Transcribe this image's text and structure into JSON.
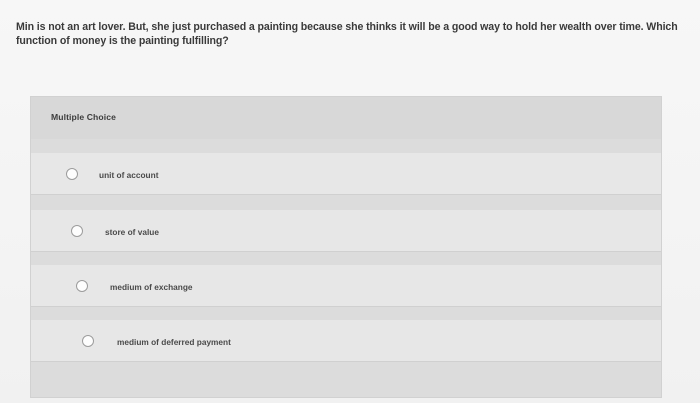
{
  "question": {
    "text": "Min is not an art lover. But, she just purchased a painting because she thinks it will be a good way to hold her wealth over time. Which function of money is the painting fulfilling?"
  },
  "card": {
    "label": "Multiple Choice"
  },
  "options": [
    {
      "label": "unit of account"
    },
    {
      "label": "store of value"
    },
    {
      "label": "medium of exchange"
    },
    {
      "label": "medium of deferred payment"
    }
  ]
}
